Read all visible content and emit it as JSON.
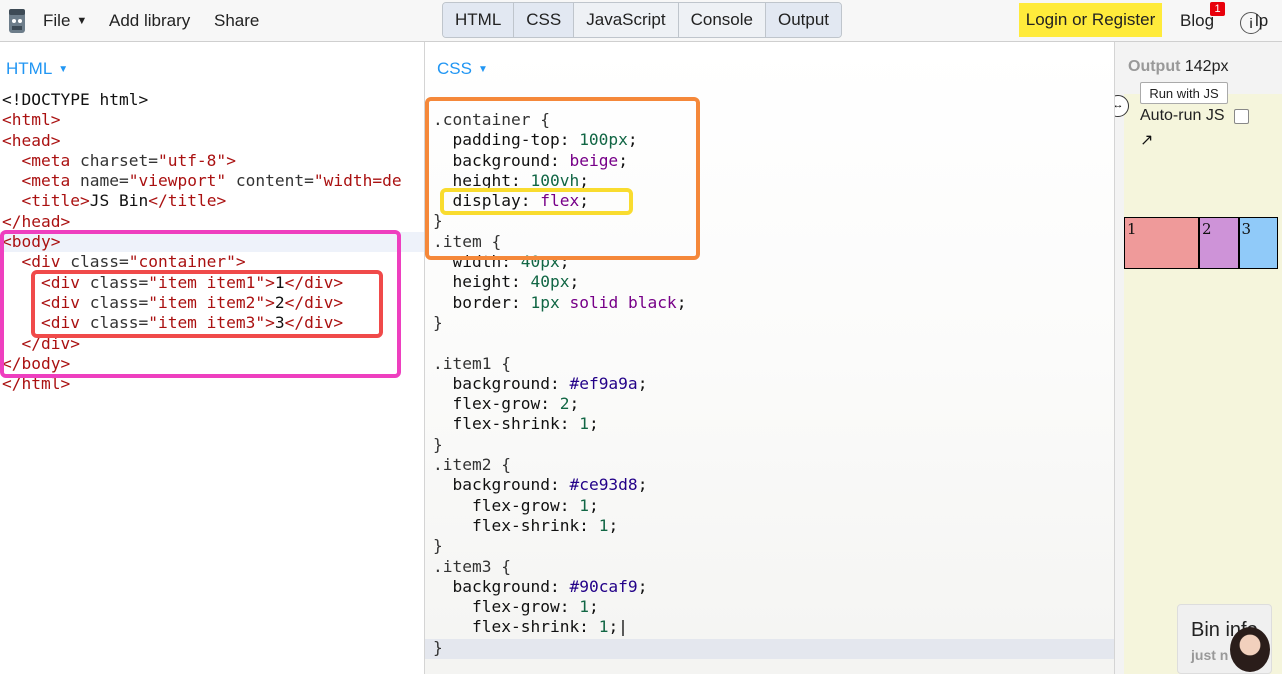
{
  "topbar": {
    "menu": {
      "file": "File",
      "add_library": "Add library",
      "share": "Share"
    },
    "tabs": [
      "HTML",
      "CSS",
      "JavaScript",
      "Console",
      "Output"
    ],
    "login": "Login or Register",
    "blog": "Blog",
    "blog_badge": "1",
    "help": "lp"
  },
  "html_panel": {
    "label": "HTML",
    "lines": [
      [
        [
          "t",
          "<!DOCTYPE html>"
        ]
      ],
      [
        [
          "tag",
          "<html>"
        ]
      ],
      [
        [
          "tag",
          "<head>"
        ]
      ],
      [
        [
          "t",
          "  "
        ],
        [
          "tag",
          "<meta"
        ],
        [
          "attr",
          " charset="
        ],
        [
          "str",
          "\"utf-8\""
        ],
        [
          "tag",
          ">"
        ]
      ],
      [
        [
          "t",
          "  "
        ],
        [
          "tag",
          "<meta"
        ],
        [
          "attr",
          " name="
        ],
        [
          "str",
          "\"viewport\""
        ],
        [
          "attr",
          " content="
        ],
        [
          "str",
          "\"width=de"
        ]
      ],
      [
        [
          "t",
          "  "
        ],
        [
          "tag",
          "<title>"
        ],
        [
          "t",
          "JS Bin"
        ],
        [
          "tag",
          "</title>"
        ]
      ],
      [
        [
          "tag",
          "</head>"
        ]
      ],
      [
        [
          "tag",
          "<body>"
        ]
      ],
      [
        [
          "t",
          "  "
        ],
        [
          "tag",
          "<div"
        ],
        [
          "attr",
          " class="
        ],
        [
          "str",
          "\"container\""
        ],
        [
          "tag",
          ">"
        ]
      ],
      [
        [
          "t",
          "    "
        ],
        [
          "tag",
          "<div"
        ],
        [
          "attr",
          " class="
        ],
        [
          "str",
          "\"item item1\""
        ],
        [
          "tag",
          ">"
        ],
        [
          "t",
          "1"
        ],
        [
          "tag",
          "</div>"
        ]
      ],
      [
        [
          "t",
          "    "
        ],
        [
          "tag",
          "<div"
        ],
        [
          "attr",
          " class="
        ],
        [
          "str",
          "\"item item2\""
        ],
        [
          "tag",
          ">"
        ],
        [
          "t",
          "2"
        ],
        [
          "tag",
          "</div>"
        ]
      ],
      [
        [
          "t",
          "    "
        ],
        [
          "tag",
          "<div"
        ],
        [
          "attr",
          " class="
        ],
        [
          "str",
          "\"item item3\""
        ],
        [
          "tag",
          ">"
        ],
        [
          "t",
          "3"
        ],
        [
          "tag",
          "</div>"
        ]
      ],
      [
        [
          "t",
          "  "
        ],
        [
          "tag",
          "</div>"
        ]
      ],
      [
        [
          "tag",
          "</body>"
        ]
      ],
      [
        [
          "tag",
          "</html>"
        ]
      ]
    ]
  },
  "css_panel": {
    "label": "CSS",
    "lines": [
      [
        [
          "sel",
          ".container {"
        ]
      ],
      [
        [
          "t",
          "  padding-top: "
        ],
        [
          "num",
          "100px"
        ],
        [
          "t",
          ";"
        ]
      ],
      [
        [
          "t",
          "  background: "
        ],
        [
          "kw",
          "beige"
        ],
        [
          "t",
          ";"
        ]
      ],
      [
        [
          "t",
          "  height: "
        ],
        [
          "num",
          "100vh"
        ],
        [
          "t",
          ";"
        ]
      ],
      [
        [
          "t",
          "  display: "
        ],
        [
          "kw",
          "flex"
        ],
        [
          "t",
          ";"
        ]
      ],
      [
        [
          "brace",
          "}"
        ]
      ],
      [
        [
          "sel",
          ".item {"
        ]
      ],
      [
        [
          "t",
          "  width: "
        ],
        [
          "num",
          "40px"
        ],
        [
          "t",
          ";"
        ]
      ],
      [
        [
          "t",
          "  height: "
        ],
        [
          "num",
          "40px"
        ],
        [
          "t",
          ";"
        ]
      ],
      [
        [
          "t",
          "  border: "
        ],
        [
          "num",
          "1px"
        ],
        [
          "t",
          " "
        ],
        [
          "kw",
          "solid"
        ],
        [
          "t",
          " "
        ],
        [
          "kw",
          "black"
        ],
        [
          "t",
          ";"
        ]
      ],
      [
        [
          "brace",
          "}"
        ]
      ],
      [
        [
          "t",
          ""
        ]
      ],
      [
        [
          "sel",
          ".item1 {"
        ]
      ],
      [
        [
          "t",
          "  background: "
        ],
        [
          "hex",
          "#ef9a9a"
        ],
        [
          "t",
          ";"
        ]
      ],
      [
        [
          "t",
          "  flex-grow: "
        ],
        [
          "num",
          "2"
        ],
        [
          "t",
          ";"
        ]
      ],
      [
        [
          "t",
          "  flex-shrink: "
        ],
        [
          "num",
          "1"
        ],
        [
          "t",
          ";"
        ]
      ],
      [
        [
          "brace",
          "}"
        ]
      ],
      [
        [
          "sel",
          ".item2 {"
        ]
      ],
      [
        [
          "t",
          "  background: "
        ],
        [
          "hex",
          "#ce93d8"
        ],
        [
          "t",
          ";"
        ]
      ],
      [
        [
          "t",
          "    flex-grow: "
        ],
        [
          "num",
          "1"
        ],
        [
          "t",
          ";"
        ]
      ],
      [
        [
          "t",
          "    flex-shrink: "
        ],
        [
          "num",
          "1"
        ],
        [
          "t",
          ";"
        ]
      ],
      [
        [
          "brace",
          "}"
        ]
      ],
      [
        [
          "sel",
          ".item3 {"
        ]
      ],
      [
        [
          "t",
          "  background: "
        ],
        [
          "hex",
          "#90caf9"
        ],
        [
          "t",
          ";"
        ]
      ],
      [
        [
          "t",
          "    flex-grow: "
        ],
        [
          "num",
          "1"
        ],
        [
          "t",
          ";"
        ]
      ],
      [
        [
          "t",
          "    flex-shrink: "
        ],
        [
          "num",
          "1"
        ],
        [
          "t",
          ";|"
        ]
      ],
      [
        [
          "brace",
          "}"
        ]
      ]
    ]
  },
  "output": {
    "title": "Output",
    "width_readout": "142px",
    "run_button": "Run with JS",
    "auto_run": "Auto-run JS",
    "items": [
      {
        "label": "1",
        "color": "#ef9a9a",
        "grow": 2
      },
      {
        "label": "2",
        "color": "#ce93d8",
        "grow": 1
      },
      {
        "label": "3",
        "color": "#90caf9",
        "grow": 1
      }
    ],
    "bin_info_title": "Bin info",
    "bin_info_sub": "just n"
  },
  "colors": {
    "accent_blue": "#2196f3",
    "login_yellow": "#ffeb3b",
    "annotation_magenta": "#ee3fbf",
    "annotation_red": "#f04a4a",
    "annotation_orange": "#f5883a",
    "annotation_yellow": "#f9dc2f"
  }
}
